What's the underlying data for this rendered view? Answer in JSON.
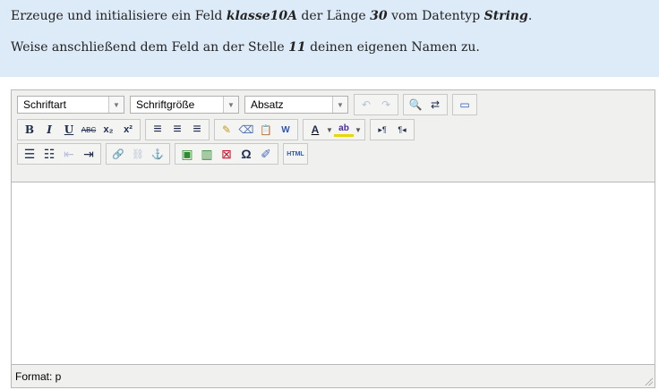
{
  "prompt": {
    "line1_a": "Erzeuge und initialisiere ein Feld ",
    "line1_b": "klasse10A",
    "line1_c": " der Länge ",
    "line1_d": "30",
    "line1_e": " vom Datentyp ",
    "line1_f": "String",
    "line1_g": ".",
    "line2_a": "Weise anschließend dem Feld an der Stelle ",
    "line2_b": "11",
    "line2_c": " deinen eigenen Namen zu."
  },
  "toolbar": {
    "font_family": "Schriftart",
    "font_size": "Schriftgröße",
    "block_format": "Absatz",
    "undo": "↶",
    "redo": "↷",
    "find": "🔍",
    "replace": "⇄",
    "fullscreen": "▭",
    "bold": "B",
    "italic": "I",
    "underline": "U",
    "strike": "ABC",
    "subscript": "x₂",
    "superscript": "x²",
    "align_left": "≡",
    "align_center": "≡",
    "align_right": "≡",
    "cleanup": "✎",
    "remove_format": "⌫",
    "paste_text": "📋",
    "paste_word": "W",
    "text_color": "A",
    "highlight": "ab",
    "ltr": "▸¶",
    "rtl": "¶◂",
    "bullet_list": "☰",
    "numbered_list": "☷",
    "outdent": "⇤",
    "indent": "⇥",
    "link": "🔗",
    "unlink": "⛓",
    "anchor": "⚓",
    "image": "▣",
    "media": "▥",
    "file": "⊠",
    "charmap": "Ω",
    "edit": "✐",
    "html": "HTML"
  },
  "status": {
    "label": "Format: p"
  },
  "colors": {
    "prompt_bg": "#ddeaf8",
    "toolbar_bg": "#f0f0ee",
    "icon": "#1e2b4a"
  }
}
